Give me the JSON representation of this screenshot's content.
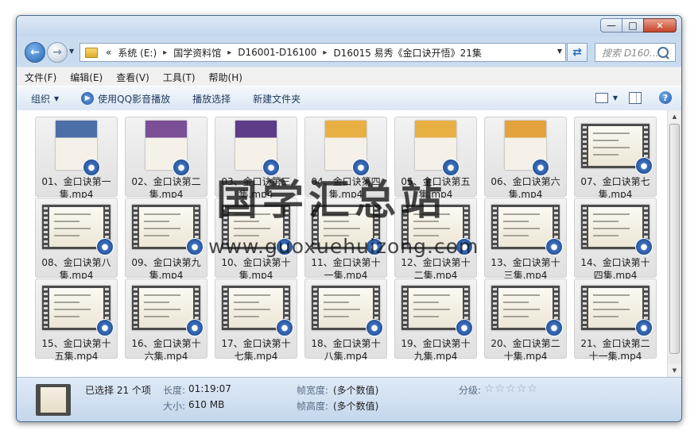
{
  "window": {
    "caption_buttons": [
      "—",
      "□",
      "✕"
    ]
  },
  "address": {
    "overflow": "«",
    "crumbs": [
      "系统 (E:)",
      "国学资料馆",
      "D16001-D16100",
      "D16015 易秀《金口诀开悟》21集"
    ],
    "separator": "▸"
  },
  "search": {
    "placeholder": "搜索 D160..."
  },
  "menu": [
    "文件(F)",
    "编辑(E)",
    "查看(V)",
    "工具(T)",
    "帮助(H)"
  ],
  "toolbar": {
    "organize": "组织",
    "play_qq": "使用QQ影音播放",
    "play_selected": "播放选择",
    "new_folder": "新建文件夹",
    "help": "?"
  },
  "files": [
    {
      "line1": "01、金口诀第一",
      "line2": "集.mp4",
      "thumb": "poster",
      "color": "#4d6fa8"
    },
    {
      "line1": "02、金口诀第二",
      "line2": "集.mp4",
      "thumb": "poster",
      "color": "#7a4f95"
    },
    {
      "line1": "03、金口诀第三",
      "line2": "集.mp4",
      "thumb": "poster",
      "color": "#5e3c8a"
    },
    {
      "line1": "04、金口诀第四",
      "line2": "集.mp4",
      "thumb": "poster",
      "color": "#e8b043"
    },
    {
      "line1": "05、金口诀第五",
      "line2": "集.mp4",
      "thumb": "poster",
      "color": "#e8b043"
    },
    {
      "line1": "06、金口诀第六",
      "line2": "集.mp4",
      "thumb": "poster",
      "color": "#e3a23b"
    },
    {
      "line1": "07、金口诀第七",
      "line2": "集.mp4",
      "thumb": "film"
    },
    {
      "line1": "08、金口诀第八",
      "line2": "集.mp4",
      "thumb": "film"
    },
    {
      "line1": "09、金口诀第九",
      "line2": "集.mp4",
      "thumb": "film"
    },
    {
      "line1": "10、金口诀第十",
      "line2": "集.mp4",
      "thumb": "film"
    },
    {
      "line1": "11、金口诀第十",
      "line2": "一集.mp4",
      "thumb": "film"
    },
    {
      "line1": "12、金口诀第十",
      "line2": "二集.mp4",
      "thumb": "film"
    },
    {
      "line1": "13、金口诀第十",
      "line2": "三集.mp4",
      "thumb": "film"
    },
    {
      "line1": "14、金口诀第十",
      "line2": "四集.mp4",
      "thumb": "film"
    },
    {
      "line1": "15、金口诀第十",
      "line2": "五集.mp4",
      "thumb": "film"
    },
    {
      "line1": "16、金口诀第十",
      "line2": "六集.mp4",
      "thumb": "film"
    },
    {
      "line1": "17、金口诀第十",
      "line2": "七集.mp4",
      "thumb": "film"
    },
    {
      "line1": "18、金口诀第十",
      "line2": "八集.mp4",
      "thumb": "film"
    },
    {
      "line1": "19、金口诀第十",
      "line2": "九集.mp4",
      "thumb": "film"
    },
    {
      "line1": "20、金口诀第二",
      "line2": "十集.mp4",
      "thumb": "film"
    },
    {
      "line1": "21、金口诀第二",
      "line2": "十一集.mp4",
      "thumb": "film"
    }
  ],
  "details": {
    "selected": "已选择 21 个项",
    "length_label": "长度:",
    "length_value": "01:19:07",
    "size_label": "大小:",
    "size_value": "610 MB",
    "frame_width_label": "帧宽度:",
    "frame_width_value": "(多个数值)",
    "frame_height_label": "帧高度:",
    "frame_height_value": "(多个数值)",
    "rating_label": "分级:",
    "rating_stars": "☆☆☆☆☆"
  },
  "watermark": {
    "cn": "国学汇总站",
    "url": "www.guoxuehuizong.com"
  }
}
